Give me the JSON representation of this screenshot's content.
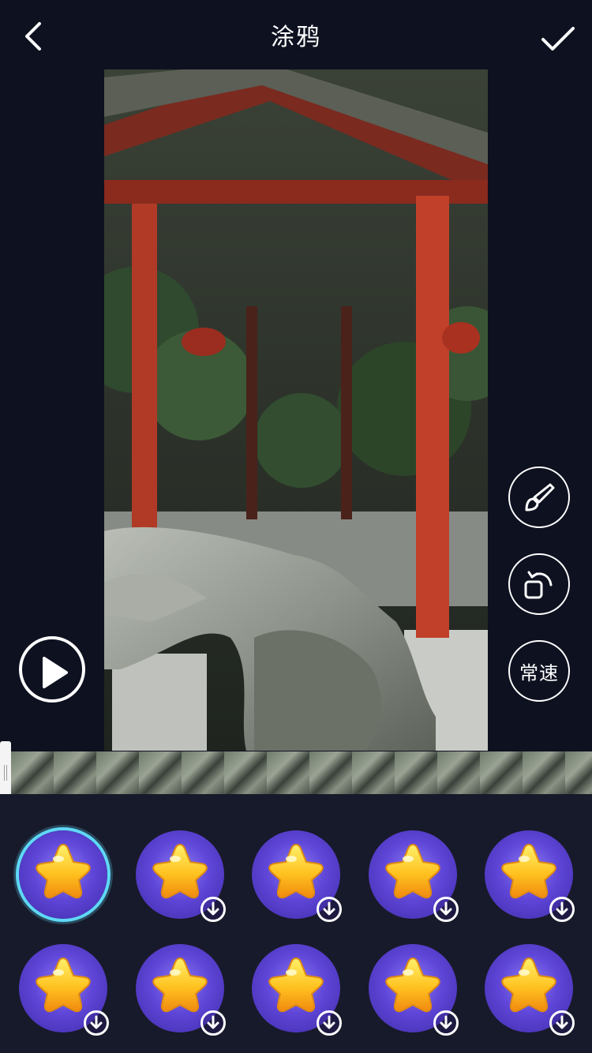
{
  "header": {
    "title": "涂鸦",
    "back_icon": "chevron-left-icon",
    "confirm_icon": "checkmark-icon"
  },
  "side_tools": {
    "brush_icon": "paintbrush-icon",
    "undo_icon": "rotate-undo-icon",
    "speed_label": "常速"
  },
  "player": {
    "play_icon": "play-icon"
  },
  "stickers": {
    "items": [
      {
        "id": 1,
        "selected": true,
        "downloaded": true
      },
      {
        "id": 2,
        "selected": false,
        "downloaded": false
      },
      {
        "id": 3,
        "selected": false,
        "downloaded": false
      },
      {
        "id": 4,
        "selected": false,
        "downloaded": false
      },
      {
        "id": 5,
        "selected": false,
        "downloaded": false
      },
      {
        "id": 6,
        "selected": false,
        "downloaded": false
      },
      {
        "id": 7,
        "selected": false,
        "downloaded": false
      },
      {
        "id": 8,
        "selected": false,
        "downloaded": false
      },
      {
        "id": 9,
        "selected": false,
        "downloaded": false
      },
      {
        "id": 10,
        "selected": false,
        "downloaded": false
      }
    ],
    "icon": "star-icon",
    "download_icon": "download-arrow-icon"
  },
  "colors": {
    "background": "#0e1120",
    "panel": "#171a2a",
    "accent": "#5fd8f6",
    "sticker_purple": "#5f46d8",
    "star_yellow": "#ffc21f"
  }
}
